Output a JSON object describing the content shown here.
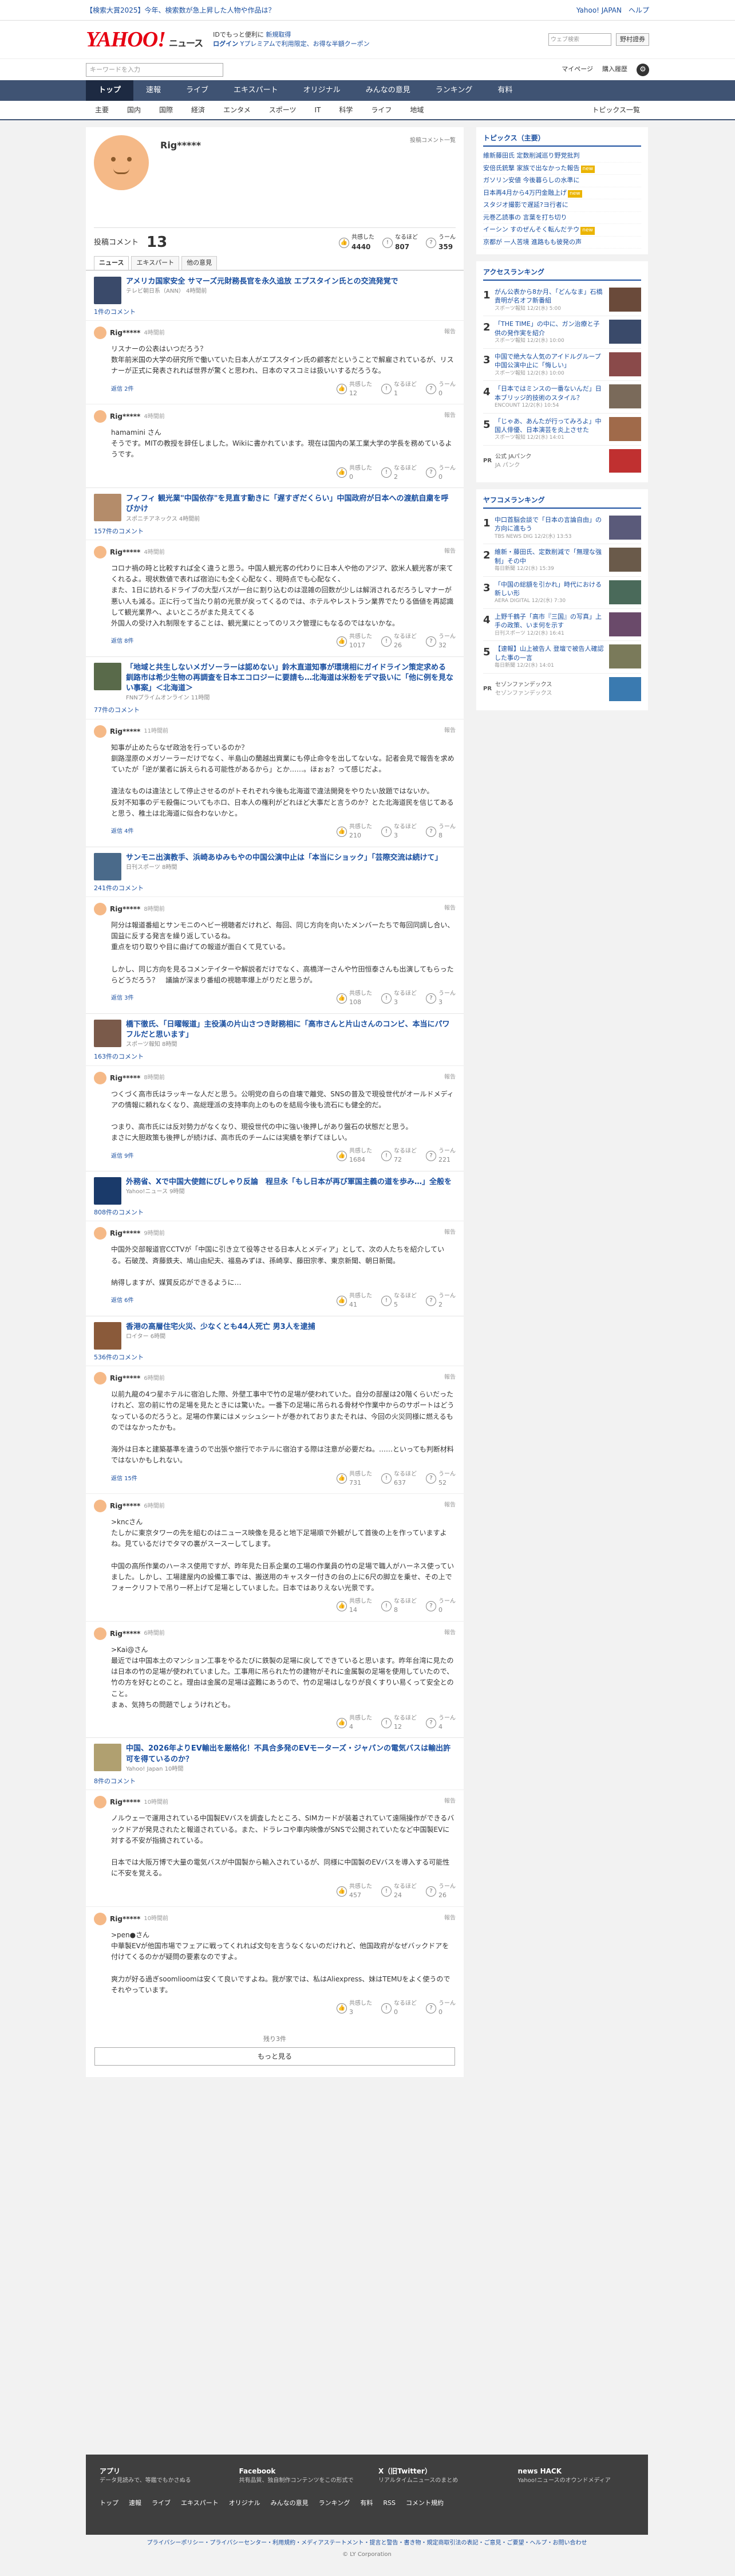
{
  "promo": {
    "left": "【検索大賞2025】今年、検索数が急上昇した人物や作品は？",
    "right": "Yahoo! JAPAN　ヘルプ"
  },
  "header": {
    "logo": "YAHOO!",
    "brand": "ニュース",
    "line1": "IDでもっと便利に",
    "line1b": "新規取得",
    "login": "ログイン",
    "line2": "Yプレミアムで利用限定、お得な半額クーポン",
    "search_ph": "ウェブ検索",
    "btn": "野村證券"
  },
  "subbar": {
    "search_ph": "キーワードを入力",
    "mypage": "マイページ",
    "purchase": "購入履歴"
  },
  "gnav": [
    "トップ",
    "速報",
    "ライブ",
    "エキスパート",
    "オリジナル",
    "みんなの意見",
    "ランキング",
    "有料"
  ],
  "snav": [
    "主要",
    "国内",
    "国際",
    "経済",
    "エンタメ",
    "スポーツ",
    "IT",
    "科学",
    "ライフ",
    "地域"
  ],
  "snav_right": "トピックス一覧",
  "profile": {
    "name": "Rig*****",
    "history": "投稿コメント一覧",
    "label": "投稿コメント",
    "count": "13",
    "v1_label": "共感した",
    "v1": "4440",
    "v2_label": "なるほど",
    "v2": "807",
    "v3_label": "うーん",
    "v3": "359"
  },
  "tabs": [
    "ニュース",
    "エキスパート",
    "他の意見"
  ],
  "articles": [
    {
      "title": "アメリカ国家安全 サマーズ元財務長官を永久追放 エプスタイン氏との交流発覚で",
      "src": "テレビ朝日系（ANN） 4時間前",
      "count": "1件のコメント",
      "color": "#3a4a6a",
      "comments": [
        {
          "name": "Rig*****",
          "time": "4時間前",
          "body": "リスナーの公表はいつだろう？\n数年前米国の大学の研究所で働いていた日本人がエプスタイン氏の顧客だということで解雇されているが、リスナーが正式に発表されれば世界が驚くと思われ、日本のマスコミは扱いいするだろうな。",
          "replies": "返信 2件",
          "a": "12",
          "b": "1",
          "c": "0"
        },
        {
          "name": "Rig*****",
          "time": "4時間前",
          "body": "hamamini さん\nそうです。MITの教授を辞任しました。Wikiに書かれています。現在は国内の某工業大学の学長を務めているようです。",
          "replies": "",
          "a": "0",
          "b": "2",
          "c": "0"
        }
      ]
    },
    {
      "title": "フィフィ 観光業\"中国依存\"を見直す動きに「遅すぎだくらい」中国政府が日本への渡航自粛を呼びかけ",
      "src": "スポニチアネックス 4時間前",
      "count": "157件のコメント",
      "color": "#b48c6a",
      "comments": [
        {
          "name": "Rig*****",
          "time": "4時間前",
          "body": "コロナ禍の時と比較すれば全く違うと思う。中国人観光客の代わりに日本人や他のアジア、欧米人観光客が来てくれるよ。現状数値で表れば宿泊にも全く心配なく、現時点でも心配なく、\nまた、1日に訪れるドライブの大型バスが一台に割り込むのは混雑の回数が少しは解消されるだろうしマナーが悪い人も減る。正に行って当たり前の光景が戻ってくるのでは、ホテルやレストラン業界でたりる価値を再認識して観光業界へ、よいところがまた見えてくる\n外国人の受け入れ制限をすることは、観光業にとってのリスク管理にもなるのではないかな。",
          "replies": "返信 8件",
          "a": "1017",
          "b": "26",
          "c": "32"
        }
      ]
    },
    {
      "title": "「地域と共生しないメガソーラーは認めない」鈴木直道知事が環境相にガイドライン策定求める 釧路市は希少生物の再調査を日本エコロジーに要請も…北海道は米粉をデマ扱いに「他に例を見ない事案」＜北海道＞",
      "src": "FNNプライムオンライン 11時間",
      "count": "77件のコメント",
      "color": "#596a4a",
      "comments": [
        {
          "name": "Rig*****",
          "time": "11時間前",
          "body": "知事が止めたらなぜ政治を行っているのか？\n釧路湿原のメガソーラーだけでなく、半島山の蘭越出資業にも停止命令を出してないな。記者会見で報告を求めていたが「逆が業者に訴えられる可能性があるから」とか……。ほぉぉ？って感じだよ。\n\n違法なものは違法として停止させるのがトそれぞれ今後も北海道で違法開発をやりたい放題ではないか。\n反対不知事のデモ殺傷についてもホロ、日本人の権利がどれほど大事だと言うのか？とた北海道民を信じてあると思う、稚土は北海道に似合わないかと。",
          "replies": "返信 4件",
          "a": "210",
          "b": "3",
          "c": "8"
        }
      ]
    },
    {
      "title": "サンモニ出演教手、浜崎あゆみもやの中国公演中止は「本当にショック」「芸際交流は続けて」",
      "src": "日刊スポーツ 8時間",
      "count": "241件のコメント",
      "color": "#4a6a8a",
      "comments": [
        {
          "name": "Rig*****",
          "time": "8時間前",
          "body": "阿分は報道番組とサンモニのヘビー視聴者だけれど、毎回、同じ方向を向いたメンバーたちで毎回同調し合い、国益に反する発言を繰り返しているね。\n重点を切り取りや目に曲げての報道が面白くて見ている。\n\nしかし、同じ方向を見るコメンテイターや解説者だけでなく、高橋洋一さんや竹田恒泰さんも出演してもらったらどうだろう？　議論が深まり番組の視聴率爆上がりだと思うが。",
          "replies": "返信 3件",
          "a": "108",
          "b": "3",
          "c": "3"
        }
      ]
    },
    {
      "title": "橋下徹氏、「日曜報道」主役漢の片山さつき財務相に「高市さんと片山さんのコンビ、本当にパワフルだと思います」",
      "src": "スポーツ報知 8時間",
      "count": "163件のコメント",
      "color": "#7a5a4a",
      "comments": [
        {
          "name": "Rig*****",
          "time": "8時間前",
          "body": "つくづく高市氏はラッキーな人だと思う。公明党の自らの自壊で離党、SNSの普及で現役世代がオールドメディアの情報に頼れなくなり、高総理派の支持率向上のものを結局今後も流石にも健全的だ。\n\nつまり、高市氏には反対勢力がなくなり、現役世代の中に強い後押しがあり盤石の状態だと思う。\nまさに大胆政策も後押しが続けば、高市氏のチームには実績を挙げてほしい。",
          "replies": "返信 9件",
          "a": "1684",
          "b": "72",
          "c": "221"
        }
      ]
    },
    {
      "title": "外務省、Xで中国大使館にびしゃり反論　程旦永「もし日本が再び軍国主義の道を歩み…」全般を",
      "src": "Yahoo!ニュース 9時間",
      "count": "808件のコメント",
      "color": "#1a3a6a",
      "comments": [
        {
          "name": "Rig*****",
          "time": "9時間前",
          "body": "中国外交部報道官CCTVが「中国に引き立て役等させる日本人とメディア」として、次の人たちを紹介している。石破茂、斉藤鉄夫、鳩山由紀夫、福島みずほ、孫崎享、藤田宗孝、東京新聞、朝日新聞。\n\n納得しますが、媒質反応ができるように…",
          "replies": "返信 6件",
          "a": "41",
          "b": "5",
          "c": "2"
        }
      ]
    },
    {
      "title": "香港の高層住宅火災、少なくとも44人死亡 男3人を逮捕",
      "src": "ロイター 6時間",
      "count": "536件のコメント",
      "color": "#8a5a3a",
      "comments": [
        {
          "name": "Rig*****",
          "time": "6時間前",
          "body": "以前九龍の4つ星ホテルに宿泊した際、外壁工事中で竹の足場が使われていた。自分の部屋は20階くらいだったけれど、窓の前に竹の足場を見たときには驚いた。一番下の足場に吊られる骨材や作業中からのサポートはどうなっているのだろうと。足場の作業にはメッシュシートが巻かれておりまたそれは、今回の火災同様に燃えるものではなかったかも。\n\n海外は日本と建築基準を違うので出張や旅行でホテルに宿泊する際は注意が必要だね。……といっても判断材料ではないかもしれない。",
          "replies": "返信 15件",
          "a": "731",
          "b": "637",
          "c": "52"
        },
        {
          "name": "Rig*****",
          "time": "6時間前",
          "body": ">kncさん\nたしかに東京タワーの先を組むのはニュース映像を見ると地下足場順で外観がして首後の上を作っていますよね。見ているだけでタマの裏がスースーしてします。\n\n中国の高所作業のハーネス使用ですが、昨年見た日系企業の工場の作業員の竹の足場で職人がハーネス使ってい ました。しかし、工場建屋内の設備工事では、搬送用のキャスター付きの台の上に6尺の脚立を乗せ、その上でフォークリフトで吊り一杯上げて足場としていました。日本ではありえない光景です。",
          "replies": "",
          "a": "14",
          "b": "8",
          "c": "0"
        },
        {
          "name": "Rig*****",
          "time": "6時間前",
          "body": ">Kai@さん\n最近では中国本土のマンション工事をやるたびに鉄製の足場に戻してできていると思います。昨年台湾に見たのは日本の竹の足場が使われていました。工事用に吊られた竹の建物がそれに金属製の足場を使用していたので、竹の方を好むとのこと。理由は金属の足場は盗難にあうので、竹の足場はしなりが良くすりい易くって安全とのこと。\nまぁ、気持ちの問題でしょうけれども。",
          "replies": "",
          "a": "4",
          "b": "12",
          "c": "4"
        }
      ]
    },
    {
      "title": "中国、2026年よりEV輸出を厳格化！不具合多発のEVモーターズ・ジャパンの電気バスは輸出許可を得ているのか？",
      "src": "Yahoo! Japan 10時間",
      "count": "8件のコメント",
      "color": "#b0a070",
      "comments": [
        {
          "name": "Rig*****",
          "time": "10時間前",
          "body": "ノルウェーで運用されている中国製EVバスを調査したところ、SIMカードが装着されていて遠隔操作ができるバックドアが発見されたと報道されている。また、ドラレコや車内映像がSNSで公開されていたなど中国製EVに対する不安が指摘されている。\n\n日本では大阪万博で大量の電気バスが中国製から輸入されているが、同様に中国製のEVバスを導入する可能性に不安を覚える。",
          "replies": "",
          "a": "457",
          "b": "24",
          "c": "26"
        },
        {
          "name": "Rig*****",
          "time": "10時間前",
          "body": ">pen●さん\n中華製EVが他国市場でフェアに戦ってくれれば文句を言うなくないのだけれど、他国政府がなぜバックドアを付けてくるのかが疑問の要素なのですよ。\n\n爽力が好る過ぎsoomlioomは安くて良いですよね。我が家では、私はAliexpress、妹はTEMUをよく使うのでそれやっています。",
          "replies": "",
          "a": "3",
          "b": "0",
          "c": "0"
        }
      ]
    }
  ],
  "more": {
    "count": "残り3件",
    "btn": "もっと見る"
  },
  "topics": {
    "title": "トピックス（主要）",
    "items": [
      {
        "t": "維新藤田氏 定数削減巡り野党批判",
        "b": ""
      },
      {
        "t": "安倍氏銃撃 家族で出なかった報告",
        "b": "new"
      },
      {
        "t": "ガソリン安値 今後暮らしの水準に",
        "b": ""
      },
      {
        "t": "日本再4月から4万円金融上げ",
        "b": "new"
      },
      {
        "t": "スタジオ撮影で遅延?ヨ行者に",
        "b": ""
      },
      {
        "t": "元巻乙読事の 言葉を打ち切り",
        "b": ""
      },
      {
        "t": "イーシン すのぜんそく転んだテウ",
        "b": "new"
      },
      {
        "t": "京都が 一人苦境 進路もも彼発の声",
        "b": ""
      }
    ]
  },
  "access": {
    "title": "アクセスランキング",
    "items": [
      {
        "t": "がん公表から8か月、「どんなま」石橋貴明が名オフ新番組",
        "s": "スポーツ報知 12/2(水) 5:00",
        "c": "#6a4a3a"
      },
      {
        "t": "「THE TIME」の中に、ガン治療と子供の発作実を紹介",
        "s": "スポーツ報知 12/2(水) 10:00",
        "c": "#3a4a6a"
      },
      {
        "t": "中国で絶大な人気のアイドルグループ 中国公演中止に「悔しい」",
        "s": "スポーツ報知 12/2(水) 10:00",
        "c": "#8a4a4a"
      },
      {
        "t": "「日本ではミンスの一番ないんだ」日本ブリッジ的技術のスタイル？",
        "s": "ENCOUNT 12/2(水) 10:54",
        "c": "#7a6a5a"
      },
      {
        "t": "「じゃあ、あんたが行ってみろよ」中国人俳優、日本演芸を炎上させた",
        "s": "スポーツ報知 12/2(水) 14:01",
        "c": "#a06a4a"
      }
    ]
  },
  "pr1": {
    "lab": "PR",
    "t": "公式 JAパンク",
    "s": "JA パンク"
  },
  "comment_rank": {
    "title": "ヤフコメランキング",
    "items": [
      {
        "t": "中口首脳会談で「日本の言論自由」の方向に進もう",
        "s": "TBS NEWS DIG 12/2(水) 13:53",
        "c": "#5a5a7a"
      },
      {
        "t": "維新・藤田氏、定数削減で「無理な強制」その中",
        "s": "毎日新聞 12/2(水) 15:39",
        "c": "#6a5a4a"
      },
      {
        "t": "「中国の総額を引かれ」時代における新しい形",
        "s": "AERA DIGITAL 12/2(水) 7:30",
        "c": "#4a6a5a"
      },
      {
        "t": "上野千鶴子「高市『三国』の写真」上手の政策、いま何を示す",
        "s": "日刊スポーツ 12/2(水) 16:41",
        "c": "#6a4a6a"
      },
      {
        "t": "【速報】山上被告人 登壇で被告人確認した事の一言",
        "s": "毎日新聞 12/2(水) 14:01",
        "c": "#7a7a5a"
      }
    ]
  },
  "pr2": {
    "lab": "PR",
    "t": "セゾンファンデックス",
    "s": "セゾンファンデックス"
  },
  "footer": {
    "sec": [
      {
        "t": "アプリ",
        "s": "データ見読みで、等鑑でもかさぬる"
      },
      {
        "t": "Facebook",
        "s": "共有品質、独自制作コンテンツをこの形式で"
      },
      {
        "t": "X（旧Twitter）",
        "s": "リアルタイムニュースのまとめ"
      },
      {
        "t": "news HACK",
        "s": "Yahoo!ニュースのオウンドメディア"
      }
    ],
    "nav": [
      "トップ",
      "速報",
      "ライブ",
      "エキスパート",
      "オリジナル",
      "みんなの意見",
      "ランキング",
      "有料",
      "RSS",
      "コメント規約"
    ],
    "links": "プライバシーポリシー・プライバシーセンター・利用規約・メディアステートメント・提言と警告・書き物・規定商取引法の表記・ご意見・ご要望・ヘルプ・お問い合わせ",
    "copy": "© LY Corporation"
  }
}
